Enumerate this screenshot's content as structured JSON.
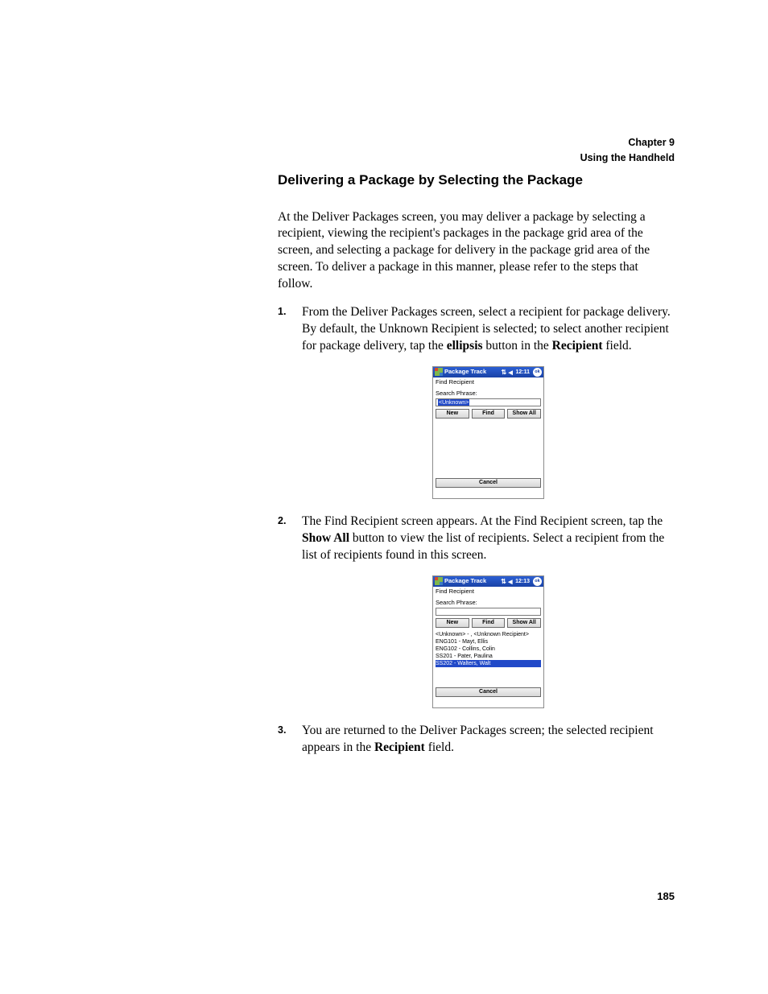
{
  "header": {
    "chapter": "Chapter 9",
    "subtitle": "Using the Handheld"
  },
  "section_title": "Delivering a Package by Selecting the Package",
  "intro": "At the Deliver Packages screen, you may deliver a package by selecting a recipient, viewing the recipient's packages in the package grid area of the screen, and selecting a package for delivery in the package grid area of the screen. To deliver a package in this manner, please refer to the steps that follow.",
  "steps": [
    {
      "pre": "From the Deliver Packages screen, select a recipient for package delivery. By default, the Unknown Recipient is selected; to select another recipient for package delivery, tap the ",
      "b1": "ellipsis",
      "mid": " button in the ",
      "b2": "Recipient",
      "post": " field."
    },
    {
      "pre": "The Find Recipient screen appears. At the Find Recipient screen, tap the ",
      "b1": "Show All",
      "mid": " button to view the list of recipients. Select a recipient from the list of recipients found in this screen.",
      "b2": "",
      "post": ""
    },
    {
      "pre": "You are returned to the Deliver Packages screen; the selected recipient appears in the ",
      "b1": "Recipient",
      "mid": " field.",
      "b2": "",
      "post": ""
    }
  ],
  "shot1": {
    "title": "Package Track",
    "time": "12:11",
    "ok": "ok",
    "screen_label": "Find Recipient",
    "search_label": "Search Phrase:",
    "search_value": "<Unknown>",
    "btn_new": "New",
    "btn_find": "Find",
    "btn_showall": "Show All",
    "btn_cancel": "Cancel"
  },
  "shot2": {
    "title": "Package Track",
    "time": "12:13",
    "ok": "ok",
    "screen_label": "Find Recipient",
    "search_label": "Search Phrase:",
    "search_value": "",
    "btn_new": "New",
    "btn_find": "Find",
    "btn_showall": "Show All",
    "btn_cancel": "Cancel",
    "rows": [
      "<Unknown> - , <Unknown Recipient>",
      "ENG101 - Mayt, Ellis",
      "ENG102 - Collins, Colin",
      "SS201 - Pater, Paulina",
      "SS202 - Walters, Walt"
    ]
  },
  "page_number": "185"
}
